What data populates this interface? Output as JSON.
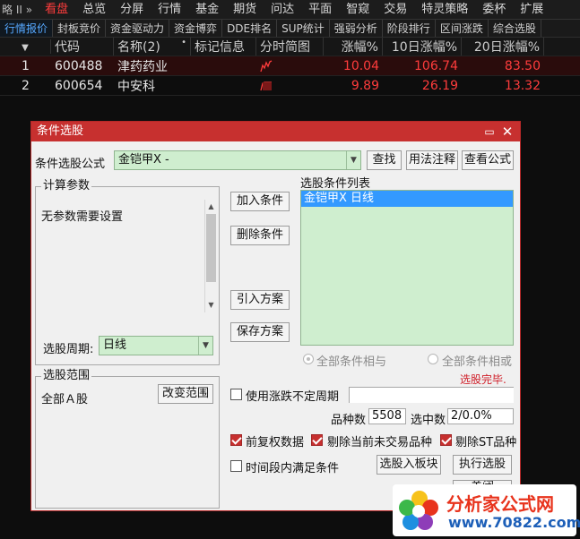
{
  "menubar": {
    "items": [
      "略 II »",
      "看盘",
      "总览",
      "分屏",
      "行情",
      "基金",
      "期货",
      "问达",
      "平面",
      "智窥",
      "交易",
      "特灵策略",
      "委杯",
      "扩展"
    ],
    "active_index": 1
  },
  "tabbar": {
    "items": [
      "行情报价",
      "封板竞价",
      "资金驱动力",
      "资金博弈",
      "DDE排名",
      "SUP统计",
      "强弱分析",
      "阶段排行",
      "区间涨跌",
      "综合选股"
    ],
    "active_index": 0
  },
  "quote_table": {
    "headers": [
      "代码",
      "名称(2)",
      "标记信息",
      "分时简图",
      "涨幅%",
      "10日涨幅%",
      "20日涨幅%"
    ],
    "sort_icon": "triangle-down-icon",
    "rows": [
      {
        "index": "1",
        "code": "600488",
        "name": "津药药业",
        "mark": "",
        "pct": "10.04",
        "d10": "106.74",
        "d20": "83.50"
      },
      {
        "index": "2",
        "code": "600654",
        "name": "中安科",
        "mark": "",
        "pct": "9.89",
        "d10": "26.19",
        "d20": "13.32"
      }
    ]
  },
  "dialog": {
    "title": "条件选股",
    "formula_label": "条件选股公式",
    "formula_value": "金铠甲X  -",
    "btn_find": "查找",
    "btn_usage": "用法注释",
    "btn_view": "查看公式",
    "calc_params_title": "计算参数",
    "calc_params_text": "无参数需要设置",
    "btn_add": "加入条件",
    "btn_delete": "删除条件",
    "btn_import": "引入方案",
    "btn_save": "保存方案",
    "cond_list_title": "选股条件列表",
    "cond_items": [
      "金铠甲X  日线"
    ],
    "period_label": "选股周期:",
    "period_value": "日线",
    "radio_and": "全部条件相与",
    "radio_or": "全部条件相或",
    "status_text": "选股完毕.",
    "scope_title": "选股范围",
    "scope_value": "全部Ａ股",
    "btn_change_scope": "改变范围",
    "chk_uncertain": "使用涨跌不定周期",
    "count_label": "品种数",
    "count_value": "5508",
    "selected_label": "选中数",
    "selected_value": "2/0.0%",
    "chk_adjust": "前复权数据",
    "chk_exclude_untraded": "剔除当前未交易品种",
    "chk_exclude_st": "剔除ST品种",
    "chk_period": "时间段内满足条件",
    "btn_to_block": "选股入板块",
    "btn_execute": "执行选股",
    "btn_close": "关闭"
  },
  "logo": {
    "title": "分析家公式网",
    "url": "www.70822.com"
  },
  "colors": {
    "accent_red": "#c7302f",
    "price_up": "#ff3c3c",
    "list_green": "#cfeecf",
    "selection_blue": "#3399ff"
  }
}
